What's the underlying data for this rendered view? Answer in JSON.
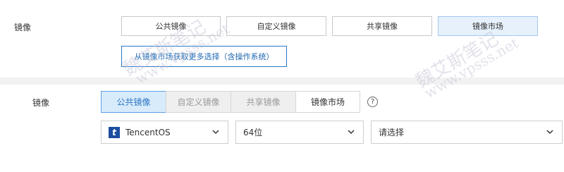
{
  "panel1": {
    "label": "镜像",
    "tabs": [
      "公共镜像",
      "自定义镜像",
      "共享镜像",
      "镜像市场"
    ],
    "active_tab": "镜像市场",
    "market_link": "从镜像市场获取更多选择（含操作系统）"
  },
  "panel2": {
    "label": "镜像",
    "tabs": [
      "公共镜像",
      "自定义镜像",
      "共享镜像",
      "镜像市场"
    ],
    "active_tab": "公共镜像",
    "help_icon": "?",
    "os_select": {
      "value": "TencentOS",
      "logo_letter": "t"
    },
    "arch_select": {
      "value": "64位"
    },
    "version_select": {
      "value": "请选择"
    }
  },
  "watermark": {
    "line1": "魏艾斯笔记",
    "line2": "www.vpsss.net"
  },
  "colors": {
    "accent": "#2b78c5",
    "active_bg": "#d8ebfb",
    "disabled_bg": "#efefef",
    "page_bg": "#f2f2f2"
  },
  "icons": {
    "help": "question-circle-icon",
    "dropdown": "chevron-down-icon",
    "os_logo": "tencentos-logo-icon"
  }
}
